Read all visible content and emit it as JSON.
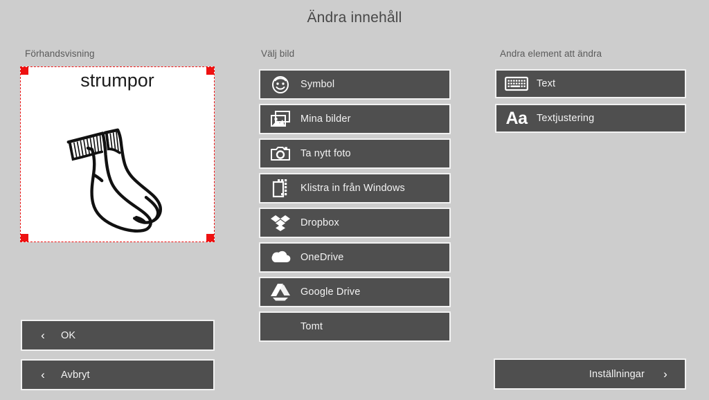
{
  "header": {
    "title": "Ändra innehåll"
  },
  "colors": {
    "background": "#cdcdcd",
    "button": "#4f4f4f",
    "button_border": "#f2f2f2",
    "selection": "#ee1111",
    "text_light": "#f3f3f3",
    "heading": "#5a5a5a"
  },
  "preview": {
    "heading": "Förhandsvisning",
    "caption": "strumpor",
    "image_name": "socks-illustration"
  },
  "choose_image": {
    "heading": "Välj bild",
    "items": [
      {
        "label": "Symbol",
        "icon": "smiley-face-icon"
      },
      {
        "label": "Mina bilder",
        "icon": "photos-icon"
      },
      {
        "label": "Ta nytt foto",
        "icon": "camera-icon"
      },
      {
        "label": "Klistra in från Windows",
        "icon": "clipboard-paste-icon"
      },
      {
        "label": "Dropbox",
        "icon": "dropbox-icon"
      },
      {
        "label": "OneDrive",
        "icon": "onedrive-cloud-icon"
      },
      {
        "label": "Google Drive",
        "icon": "google-drive-icon"
      },
      {
        "label": "Tomt",
        "icon": "none"
      }
    ]
  },
  "other_elements": {
    "heading": "Andra element att ändra",
    "items": [
      {
        "label": "Text",
        "icon": "keyboard-icon"
      },
      {
        "label": "Textjustering",
        "icon": "aa-text-icon"
      }
    ]
  },
  "nav": {
    "ok_label": "OK",
    "cancel_label": "Avbryt",
    "back_chevron": "‹",
    "forward_chevron": "›",
    "settings_label": "Inställningar"
  }
}
